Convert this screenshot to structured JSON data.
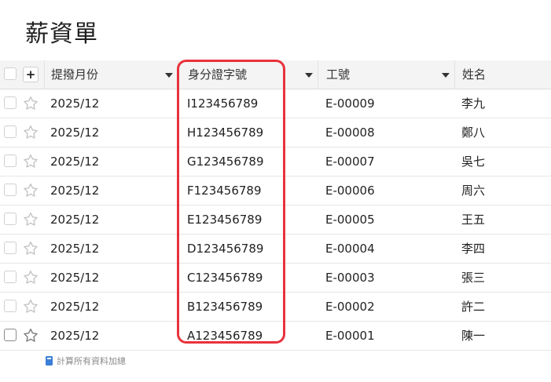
{
  "page": {
    "title": "薪資單"
  },
  "columns": {
    "month": "提撥月份",
    "id_number": "身分證字號",
    "employee_no": "工號",
    "name": "姓名"
  },
  "add_label": "+",
  "rows": [
    {
      "month": "2025/12",
      "id_number": "I123456789",
      "employee_no": "E-00009",
      "name": "李九"
    },
    {
      "month": "2025/12",
      "id_number": "H123456789",
      "employee_no": "E-00008",
      "name": "鄭八"
    },
    {
      "month": "2025/12",
      "id_number": "G123456789",
      "employee_no": "E-00007",
      "name": "吳七"
    },
    {
      "month": "2025/12",
      "id_number": "F123456789",
      "employee_no": "E-00006",
      "name": "周六"
    },
    {
      "month": "2025/12",
      "id_number": "E123456789",
      "employee_no": "E-00005",
      "name": "王五"
    },
    {
      "month": "2025/12",
      "id_number": "D123456789",
      "employee_no": "E-00004",
      "name": "李四"
    },
    {
      "month": "2025/12",
      "id_number": "C123456789",
      "employee_no": "E-00003",
      "name": "張三"
    },
    {
      "month": "2025/12",
      "id_number": "B123456789",
      "employee_no": "E-00002",
      "name": "許二"
    },
    {
      "month": "2025/12",
      "id_number": "A123456789",
      "employee_no": "E-00001",
      "name": "陳一"
    }
  ],
  "footer": {
    "sum_all": "計算所有資料加總"
  },
  "colors": {
    "highlight": "#e8323c",
    "footer_icon": "#3b7fd6"
  }
}
